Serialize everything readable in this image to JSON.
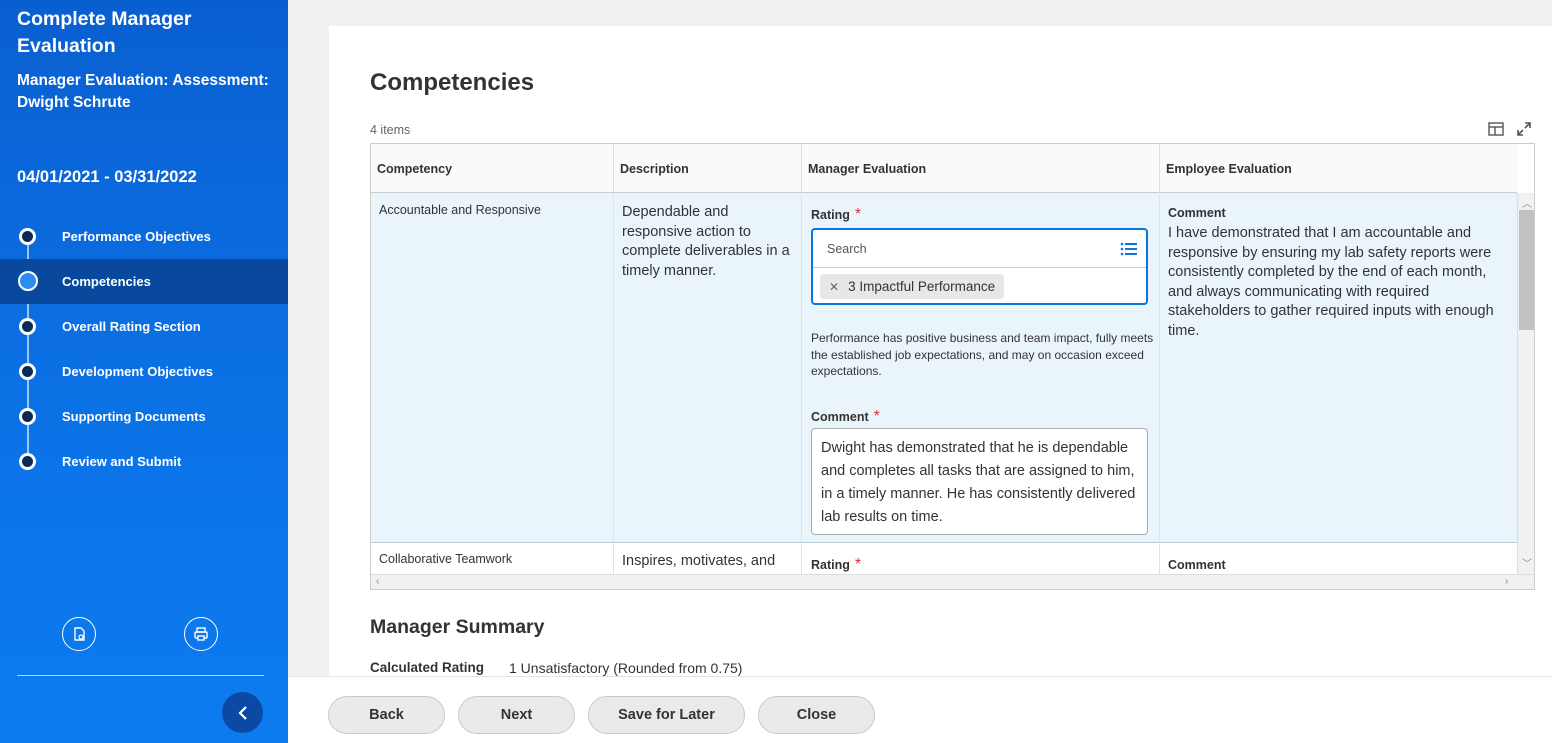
{
  "sidebar": {
    "title": "Complete Manager Evaluation",
    "subtitle": "Manager Evaluation: Assessment: Dwight Schrute",
    "period": "04/01/2021 - 03/31/2022",
    "steps": [
      {
        "label": "Performance Objectives",
        "active": false
      },
      {
        "label": "Competencies",
        "active": true
      },
      {
        "label": "Overall Rating Section",
        "active": false
      },
      {
        "label": "Development Objectives",
        "active": false
      },
      {
        "label": "Supporting Documents",
        "active": false
      },
      {
        "label": "Review and Submit",
        "active": false
      }
    ],
    "icons": [
      "document-icon",
      "print-icon"
    ],
    "collapse_icon": "chevron-left-icon"
  },
  "main": {
    "heading": "Competencies",
    "items_count": "4 items",
    "columns": [
      "Competency",
      "Description",
      "Manager Evaluation",
      "Employee Evaluation"
    ],
    "rows": [
      {
        "competency": "Accountable and Responsive",
        "description": "Dependable and responsive action to complete deliverables in a timely manner.",
        "rating_label": "Rating",
        "search_placeholder": "Search",
        "selected_rating": "3 Impactful Performance",
        "rating_description": "Performance has positive business and team impact, fully meets the established job expectations, and may on occasion exceed expectations.",
        "comment_label": "Comment",
        "manager_comment": "Dwight has demonstrated that he is dependable and completes all tasks that are assigned to him, in a timely manner. He has consistently delivered lab results on time.",
        "employee_comment_label": "Comment",
        "employee_comment": "I have demonstrated that I am accountable and responsive by ensuring my lab safety reports were consistently completed by the end of each month, and always communicating with required stakeholders to gather required inputs with enough time."
      },
      {
        "competency": "Collaborative Teamwork",
        "description": "Inspires, motivates, and",
        "rating_label": "Rating",
        "employee_comment_label": "Comment"
      }
    ],
    "required_mark": "*",
    "summary_heading": "Manager Summary",
    "calculated_rating_label": "Calculated Rating",
    "calculated_rating_value": "1 Unsatisfactory (Rounded from 0.75)"
  },
  "footer": {
    "back": "Back",
    "next": "Next",
    "save": "Save for Later",
    "close": "Close"
  },
  "colors": {
    "sidebar_blue": "#0b6bdc",
    "active_step": "#08499e",
    "accent": "#0875e1",
    "required": "#de2f3a",
    "row_highlight": "#e9f5fb"
  }
}
